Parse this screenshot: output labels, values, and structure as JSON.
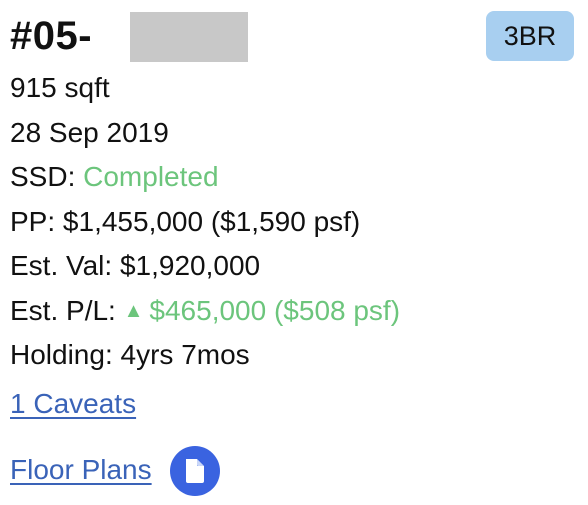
{
  "unit": {
    "prefix": "#05-",
    "badge": "3BR"
  },
  "details": {
    "area": "915 sqft",
    "date": "28 Sep 2019",
    "ssd_label": "SSD: ",
    "ssd_value": "Completed",
    "pp_label": "PP: ",
    "pp_value": "$1,455,000 ($1,590 psf)",
    "est_val_label": "Est. Val: ",
    "est_val_value": "$1,920,000",
    "est_pl_label": "Est. P/L: ",
    "est_pl_triangle": "▲",
    "est_pl_value": "$465,000 ($508 psf)",
    "holding_label": "Holding: ",
    "holding_value": "4yrs 7mos"
  },
  "links": {
    "caveats": "1 Caveats",
    "floor_plans": "Floor Plans"
  },
  "colors": {
    "positive": "#6cc57c",
    "link": "#3a63b8",
    "badge_bg": "#a8cff0",
    "icon_bg": "#3a63e0"
  },
  "icons": {
    "floor_plan_icon": "document-icon"
  }
}
